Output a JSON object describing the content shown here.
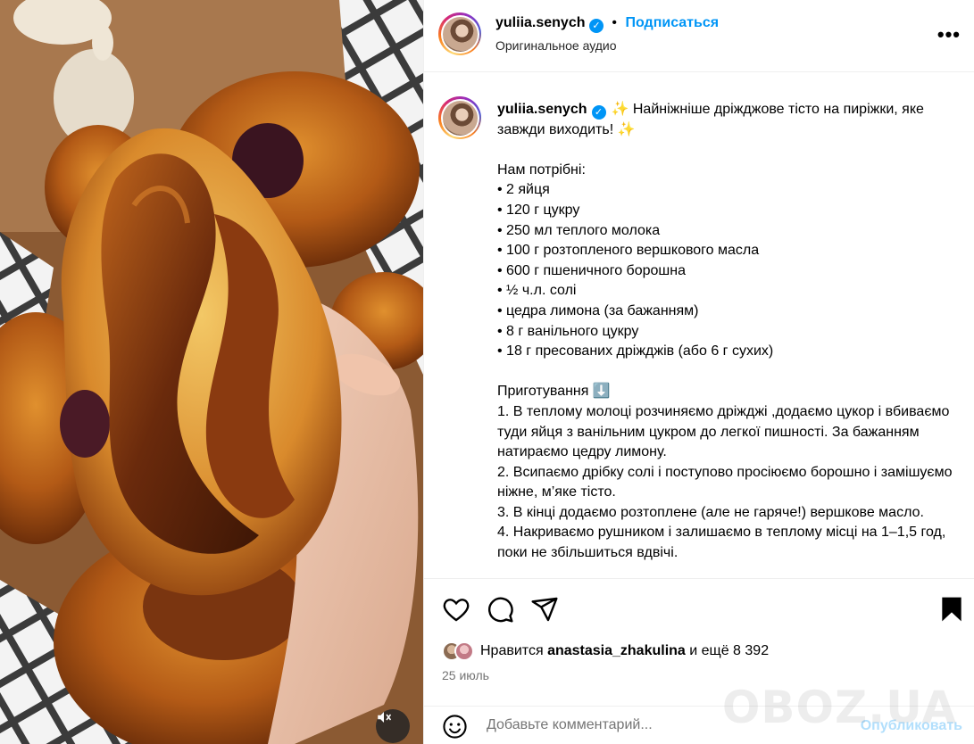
{
  "header": {
    "username": "yuliia.senych",
    "separator": "•",
    "follow_label": "Подписаться",
    "audio_label": "Оригинальное аудио",
    "more_label": "•••"
  },
  "caption": {
    "username": "yuliia.senych",
    "text": "✨ Найніжніше дріжджове тісто на пиріжки, яке завжди виходить! ✨\n\nНам потрібні:\n• 2 яйця\n• 120 г цукру\n• 250 мл теплого молока\n• 100 г розтопленого вершкового масла\n• 600 г пшеничного борошна\n• ½ ч.л. солі\n• цедра лимона (за бажанням)\n• 8 г ванільного цукру\n• 18 г пресованих дріжджів (або 6 г сухих)\n\nПриготування ⬇️\n1. В теплому молоці розчиняємо дріжджі ,додаємо цукор і вбиваємо туди яйця з ванільним цукром до легкої пишності. За бажанням натираємо цедру лимону.\n2. Всипаємо дрібку солі і поступово просіюємо борошно і замішуємо ніжне, м’яке тісто.\n3. В кінці додаємо розтоплене (але не гаряче!) вершкове масло.\n4. Накриваємо рушником і залишаємо в теплому місці на 1–1,5 год, поки не збільшиться вдвічі."
  },
  "likes": {
    "prefix": "Нравится",
    "user": "anastasia_zhakulina",
    "suffix": "и ещё 8 392"
  },
  "date": "25 июль",
  "comment": {
    "placeholder": "Добавьте комментарий...",
    "publish_label": "Опубликовать"
  },
  "watermark": "OBOZ.UA",
  "icons": {
    "like": "heart-icon",
    "comment": "comment-icon",
    "share": "share-icon",
    "save": "bookmark-icon",
    "emoji": "emoji-icon",
    "mute": "speaker-muted-icon",
    "verified": "verified-badge-icon"
  },
  "colors": {
    "link_blue": "#0095f6",
    "publish_disabled": "#b2dffc",
    "secondary_text": "#737373"
  }
}
